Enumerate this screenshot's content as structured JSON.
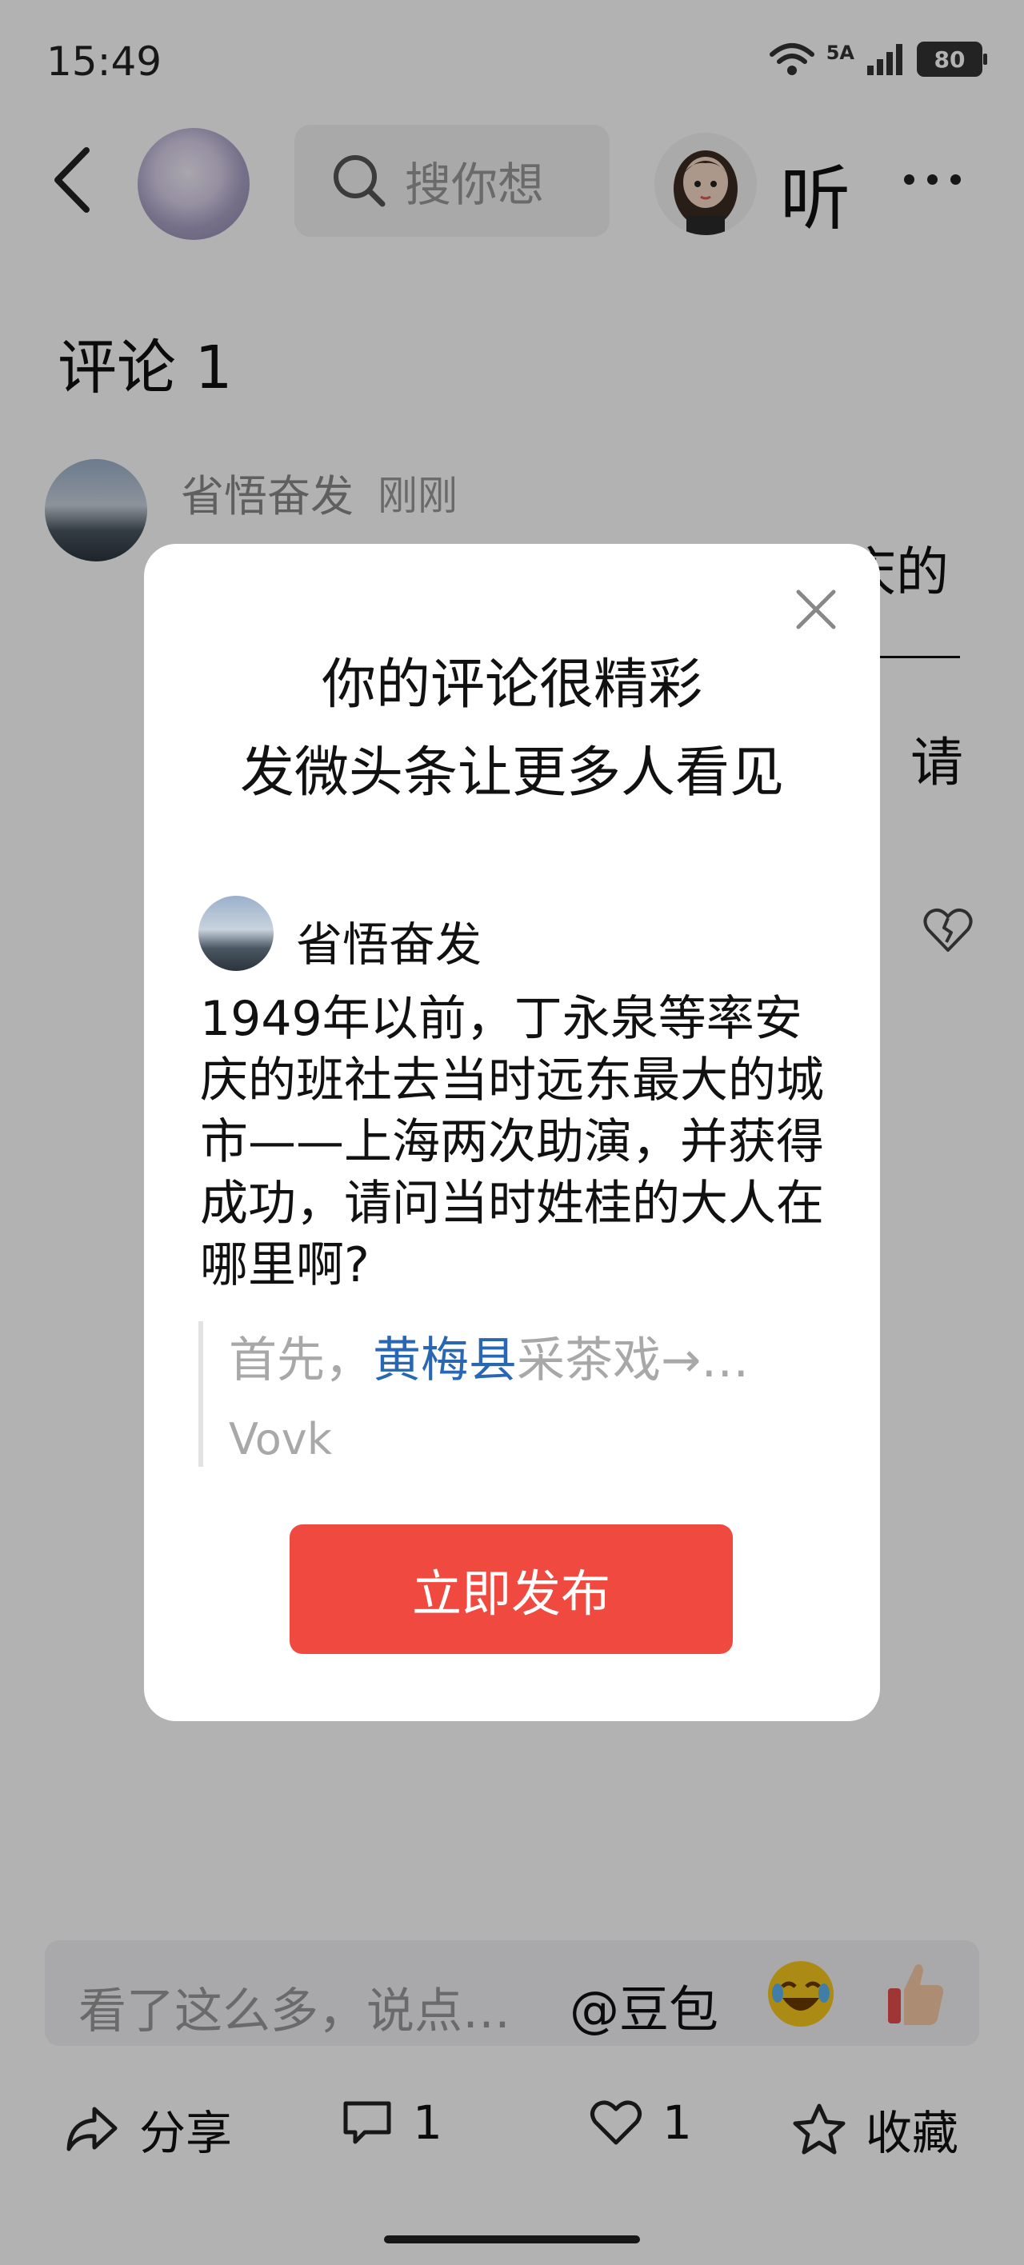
{
  "status_bar": {
    "time": "15:49",
    "network": "5A",
    "battery": "80"
  },
  "header": {
    "search_placeholder": "搜你想",
    "listen_label": "听"
  },
  "comments": {
    "title": "评论 1",
    "items": [
      {
        "user": "省悟奋发",
        "time": "刚刚",
        "line1": "1949年以前，丁永泉等率安庆的",
        "partial": "请"
      }
    ]
  },
  "modal": {
    "title_line1": "你的评论很精彩",
    "title_line2": "发微头条让更多人看见",
    "user": "省悟奋发",
    "body": "1949年以前，丁永泉等率安庆的班社去当时远东最大的城市——上海两次助演，并获得成功，请问当时姓桂的大人在哪里啊?",
    "quote_prefix": "首先，",
    "quote_link": "黄梅县",
    "quote_suffix": "采茶戏→…",
    "quote_source": "Vovk",
    "publish_label": "立即发布"
  },
  "bottom": {
    "input_placeholder": "看了这么多，说点…",
    "mention": "@豆包",
    "share_label": "分享",
    "comment_count": "1",
    "like_count": "1",
    "favorite_label": "收藏"
  },
  "colors": {
    "publish_button": "#f04a40",
    "link": "#2a67b2",
    "overlay": "rgba(0,0,0,0.30)"
  }
}
